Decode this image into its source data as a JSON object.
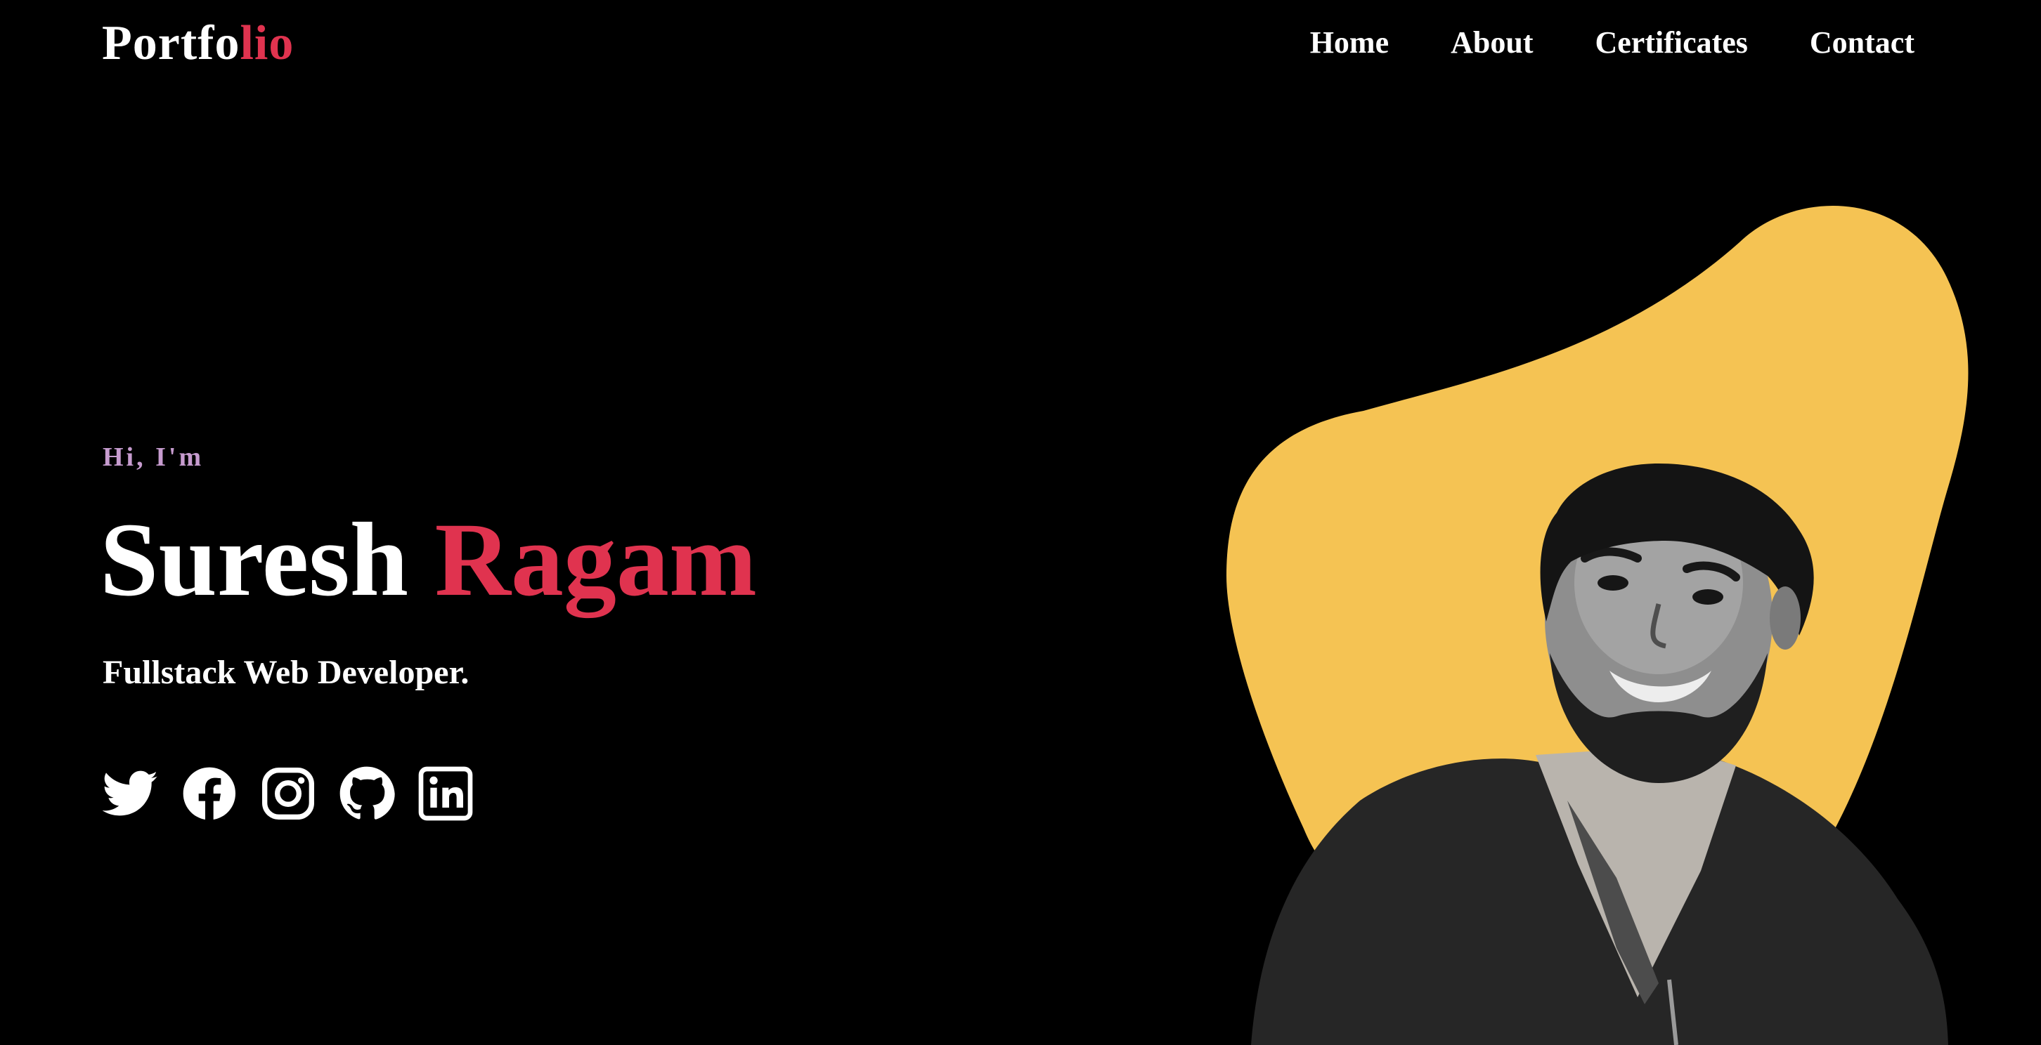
{
  "header": {
    "logo_main": "Portfo",
    "logo_accent": "lio",
    "nav": [
      {
        "label": "Home"
      },
      {
        "label": "About"
      },
      {
        "label": "Certificates"
      },
      {
        "label": "Contact"
      }
    ]
  },
  "hero": {
    "greeting": "Hi, I'm",
    "first_name": "Suresh",
    "last_name": "Ragam",
    "role": "Fullstack Web Developer."
  },
  "socials": [
    {
      "icon": "twitter-icon"
    },
    {
      "icon": "facebook-icon"
    },
    {
      "icon": "instagram-icon"
    },
    {
      "icon": "github-icon"
    },
    {
      "icon": "linkedin-icon"
    }
  ],
  "colors": {
    "background": "#000000",
    "accent": "#e0334f",
    "greeting": "#c79ccf",
    "blob": "#f5c353",
    "text": "#ffffff"
  }
}
